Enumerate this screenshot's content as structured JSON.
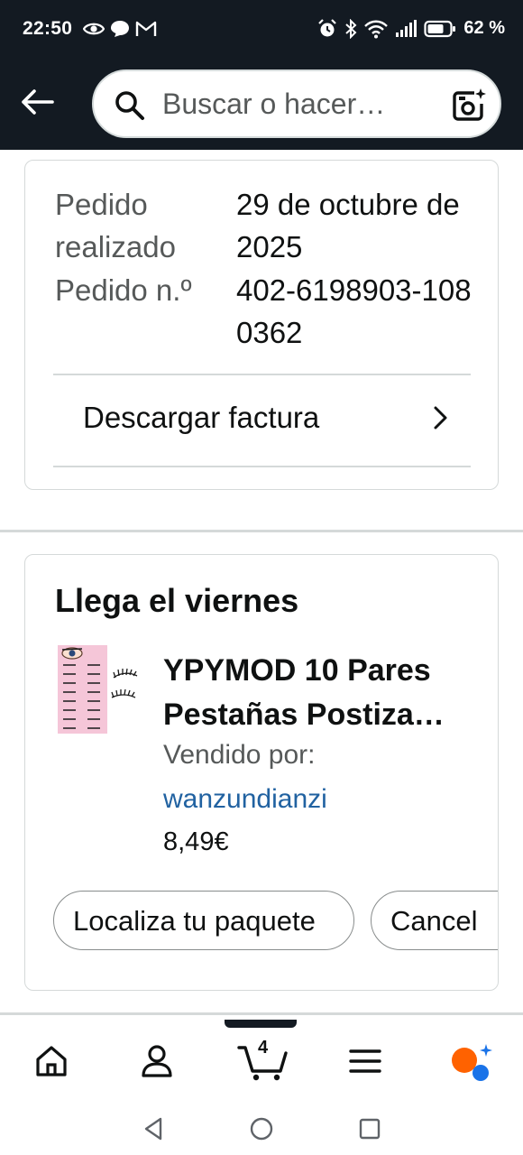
{
  "status_bar": {
    "time": "22:50",
    "battery_percent": "62 %",
    "left_icons": [
      "eye-icon",
      "chat-bubble-icon",
      "gmail-icon"
    ],
    "right_icons": [
      "alarm-icon",
      "bluetooth-icon",
      "wifi-icon",
      "signal-icon",
      "battery-icon"
    ]
  },
  "header": {
    "search_placeholder": "Buscar o hacer…",
    "icons": [
      "back-arrow-icon",
      "search-icon",
      "camera-icon"
    ]
  },
  "order": {
    "placed_label": "Pedido realizado",
    "placed_value": "29 de octubre de 2025",
    "number_label": "Pedido n.º",
    "number_value": "402-6198903-1080362",
    "invoice_label": "Descargar factura"
  },
  "delivery": {
    "heading": "Llega el viernes",
    "product_title": "YPYMOD 10 Pares Pestañas Postiza…",
    "sold_by_label": "Vendido por:",
    "seller": "wanzundianzi",
    "price": "8,49€",
    "track_button": "Localiza tu paquete",
    "cancel_button": "Cancel"
  },
  "bottom_nav": {
    "cart_count": "4",
    "items": [
      "home-icon",
      "account-icon",
      "cart-icon",
      "menu-icon",
      "rufus-ai-icon"
    ]
  },
  "colors": {
    "header_bg": "#131a22",
    "link": "#2162a1",
    "ai_orange": "#ff6200",
    "ai_blue": "#1a73e8"
  }
}
